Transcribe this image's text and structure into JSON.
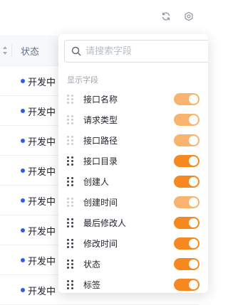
{
  "toolbar": {
    "refresh_icon": "refresh-icon",
    "settings_icon": "gear-icon"
  },
  "table": {
    "status_header": "状态",
    "rows": [
      "开发中",
      "开发中",
      "开发中",
      "开发中",
      "开发中",
      "开发中",
      "开发中",
      "开发中"
    ],
    "status_color": "#2f5bea"
  },
  "column_panel": {
    "search": {
      "placeholder": "请搜索字段",
      "value": ""
    },
    "section_title": "显示字段",
    "accent_color": "#f5891f",
    "fields": [
      {
        "label": "接口名称",
        "enabled": true,
        "locked": true
      },
      {
        "label": "请求类型",
        "enabled": true,
        "locked": true
      },
      {
        "label": "接口路径",
        "enabled": true,
        "locked": true
      },
      {
        "label": "接口目录",
        "enabled": true,
        "locked": false
      },
      {
        "label": "创建人",
        "enabled": true,
        "locked": false
      },
      {
        "label": "创建时间",
        "enabled": true,
        "locked": true
      },
      {
        "label": "最后修改人",
        "enabled": true,
        "locked": false
      },
      {
        "label": "修改时间",
        "enabled": true,
        "locked": false
      },
      {
        "label": "状态",
        "enabled": true,
        "locked": false
      },
      {
        "label": "标签",
        "enabled": true,
        "locked": false
      }
    ]
  }
}
